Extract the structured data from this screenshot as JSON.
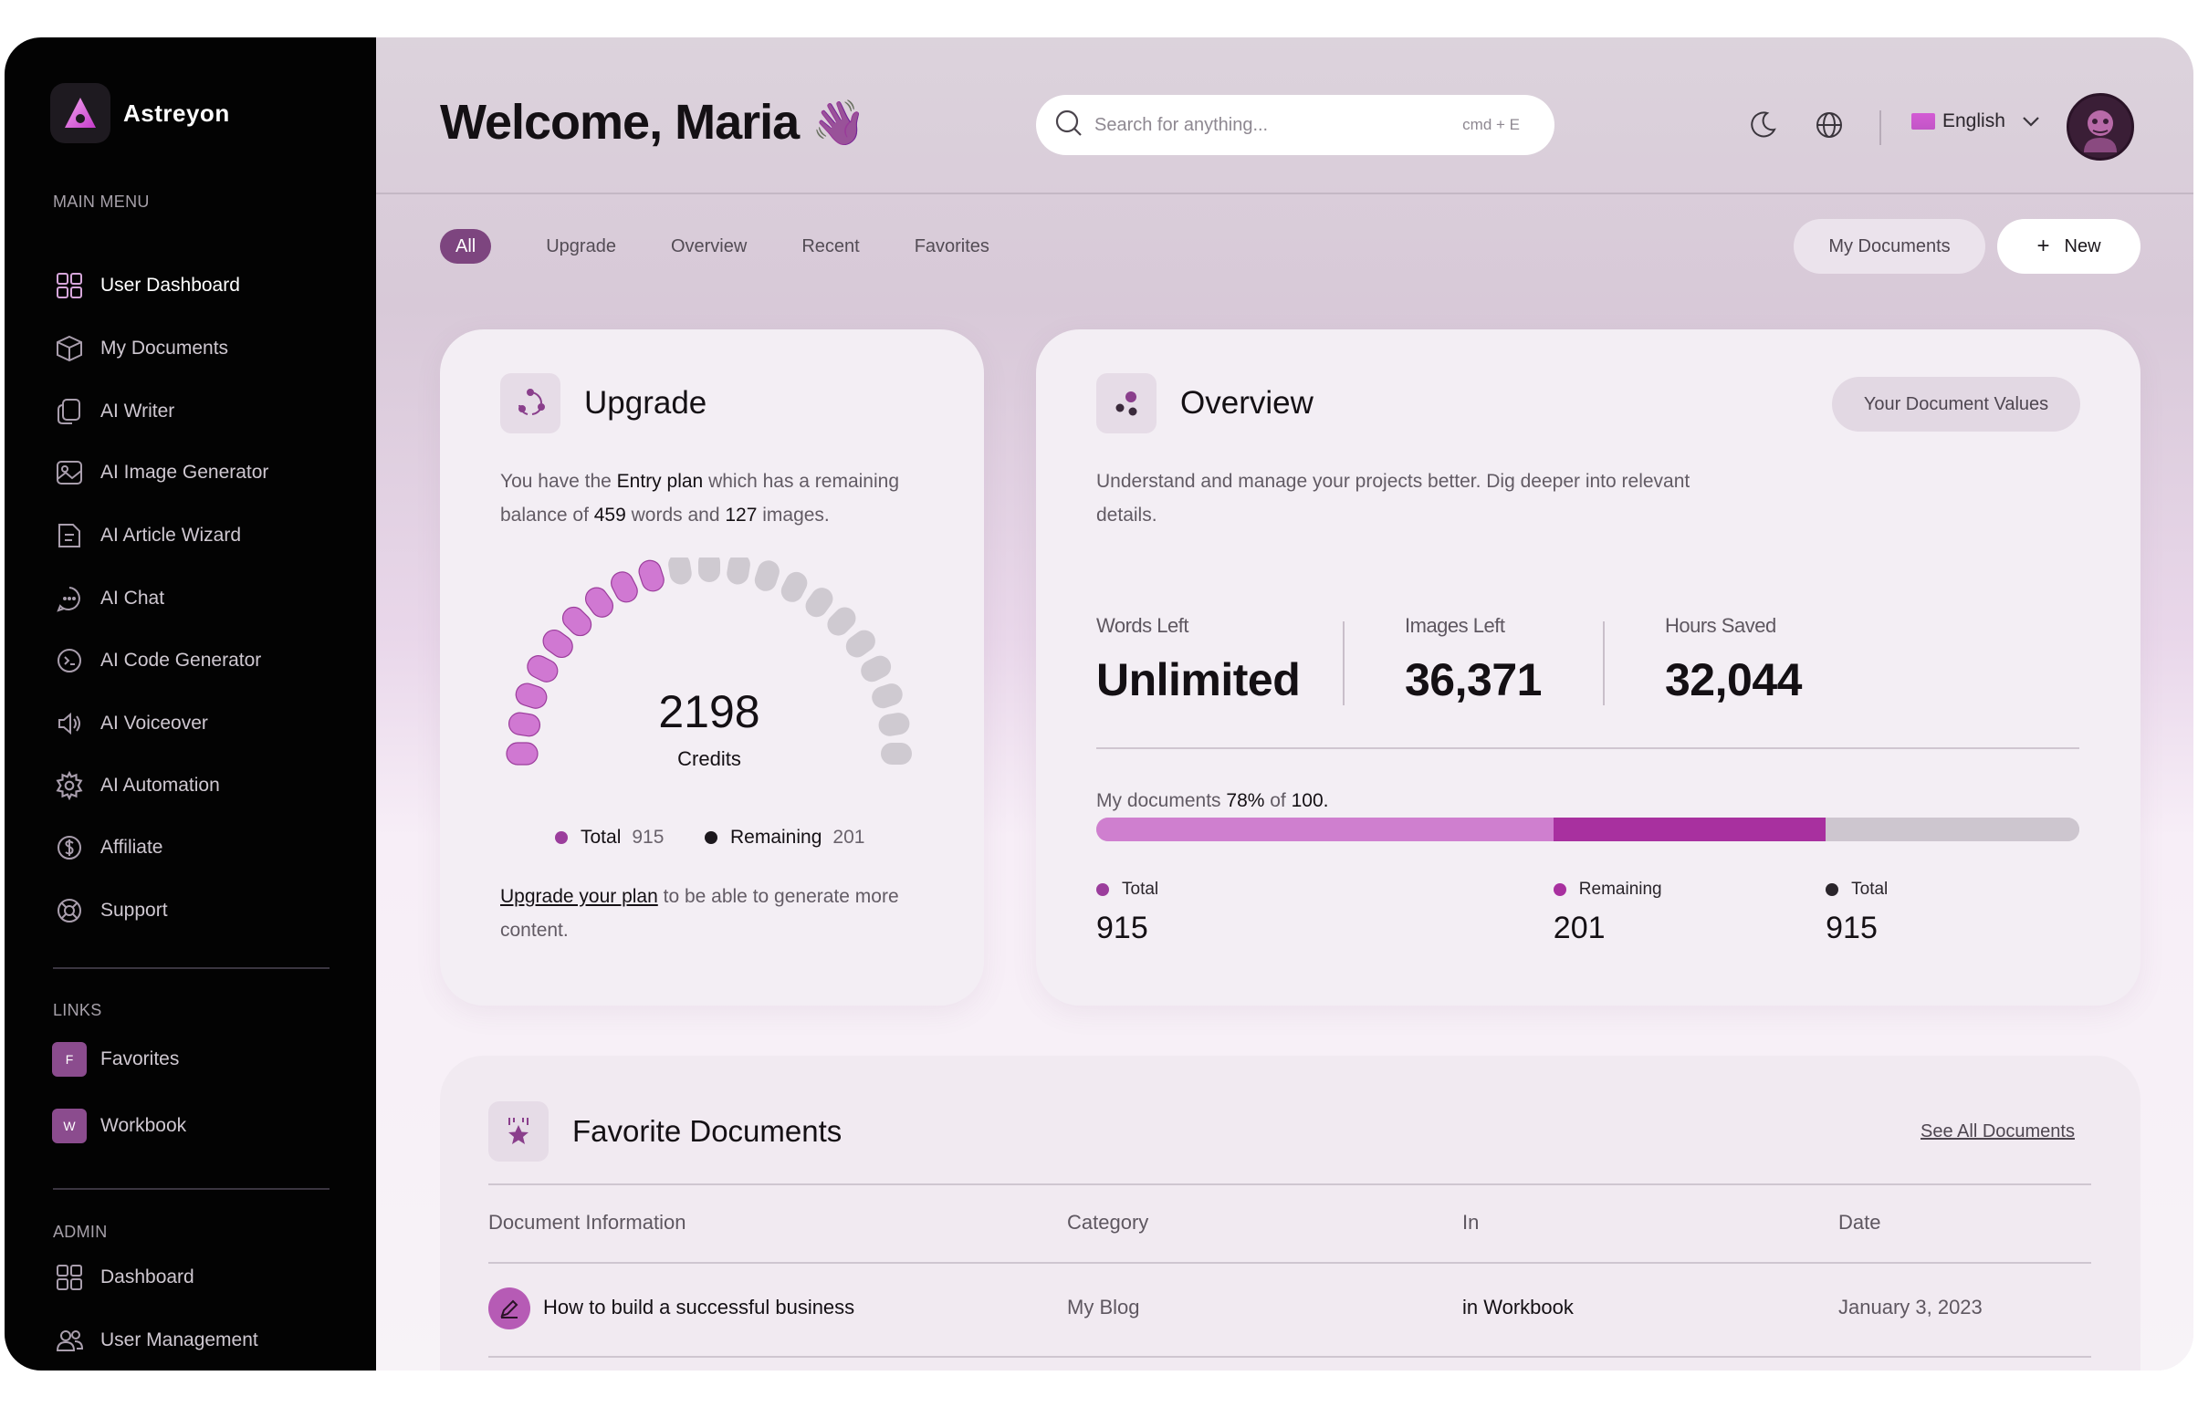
{
  "brand": {
    "name": "Astreyon"
  },
  "sidebar": {
    "main_menu_title": "MAIN MENU",
    "items": [
      {
        "label": "User Dashboard",
        "icon": "grid-icon"
      },
      {
        "label": "My Documents",
        "icon": "box-icon"
      },
      {
        "label": "AI Writer",
        "icon": "pages-icon"
      },
      {
        "label": "AI Image Generator",
        "icon": "image-icon"
      },
      {
        "label": "AI Article Wizard",
        "icon": "document-icon"
      },
      {
        "label": "AI Chat",
        "icon": "chat-icon"
      },
      {
        "label": "AI Code Generator",
        "icon": "terminal-icon"
      },
      {
        "label": "AI Voiceover",
        "icon": "speaker-icon"
      },
      {
        "label": "AI Automation",
        "icon": "gear-icon"
      },
      {
        "label": "Affiliate",
        "icon": "dollar-icon"
      },
      {
        "label": "Support",
        "icon": "lifebuoy-icon"
      }
    ],
    "links_title": "LINKS",
    "links": [
      {
        "badge": "F",
        "label": "Favorites"
      },
      {
        "badge": "W",
        "label": "Workbook"
      }
    ],
    "admin_title": "ADMIN",
    "admin_items": [
      {
        "label": "Dashboard",
        "icon": "grid-icon"
      },
      {
        "label": "User Management",
        "icon": "users-icon"
      }
    ]
  },
  "header": {
    "welcome": "Welcome, Maria",
    "wave_emoji": "👋",
    "search_placeholder": "Search for anything...",
    "search_shortcut": "cmd + E",
    "language": "English"
  },
  "tabs": [
    "All",
    "Upgrade",
    "Overview",
    "Recent",
    "Favorites"
  ],
  "actions": {
    "my_documents": "My Documents",
    "new": "New",
    "new_icon": "+"
  },
  "upgrade": {
    "title": "Upgrade",
    "text_1": "You have the ",
    "plan": "Entry plan",
    "text_2": " which has a remaining",
    "text_3": "balance of ",
    "words": "459",
    "text_4": " words and ",
    "images": "127",
    "text_5": " images.",
    "gauge_value": "2198",
    "gauge_label": "Credits",
    "gauge_filled_fraction": 0.43,
    "legend": [
      {
        "label": "Total",
        "value": "915",
        "color": "#9b3d9c"
      },
      {
        "label": "Remaining",
        "value": "201",
        "color": "#1c181d"
      }
    ],
    "footer_link": "Upgrade your plan",
    "footer_text_1": " to be able to generate more",
    "footer_text_2": "content."
  },
  "overview": {
    "title": "Overview",
    "badge": "Your Document Values",
    "desc_1": "Understand and manage your projects better. Dig deeper into relevant",
    "desc_2": "details.",
    "stats": [
      {
        "label": "Words Left",
        "value": "Unlimited"
      },
      {
        "label": "Images Left",
        "value": "36,371"
      },
      {
        "label": "Hours Saved",
        "value": "32,044"
      }
    ],
    "docs_prefix": "My documents ",
    "docs_percent": "78%",
    "docs_mid": " of ",
    "docs_total": "100.",
    "bar": [
      {
        "label": "Total",
        "value": "915",
        "fraction": 0.465,
        "color": "#cf7fcf"
      },
      {
        "label": "Remaining",
        "value": "201",
        "fraction": 0.277,
        "color": "#a8309f"
      },
      {
        "label": "Total",
        "value": "915",
        "fraction": 0.258,
        "color": "#cdc6cf"
      }
    ],
    "legend_colors": [
      "#9b3d9c",
      "#a8309f",
      "#2a252b"
    ]
  },
  "favorites": {
    "title": "Favorite Documents",
    "see_all": "See All Documents",
    "columns": [
      "Document Information",
      "Category",
      "In",
      "Date"
    ],
    "rows": [
      {
        "name": "How to build a successful business",
        "category": "My Blog",
        "in": "in Workbook",
        "date": "January 3, 2023"
      }
    ]
  }
}
